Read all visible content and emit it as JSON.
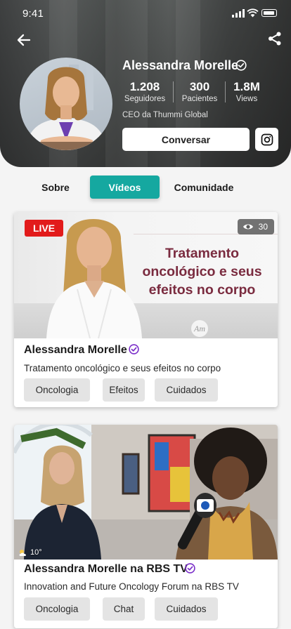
{
  "status_bar": {
    "time": "9:41"
  },
  "profile": {
    "name": "Alessandra Morelle",
    "stats": [
      {
        "value": "1.208",
        "label": "Seguidores"
      },
      {
        "value": "300",
        "label": "Pacientes"
      },
      {
        "value": "1.8M",
        "label": "Views"
      }
    ],
    "role": "CEO da Thummi Global",
    "message_button": "Conversar"
  },
  "tabs": [
    {
      "label": "Sobre",
      "active": false
    },
    {
      "label": "Vídeos",
      "active": true
    },
    {
      "label": "Comunidade",
      "active": false
    }
  ],
  "videos": [
    {
      "badge": "LIVE",
      "views": "30",
      "thumbnail_text": "Tratamento oncológico e seus efeitos no corpo",
      "title": "Alessandra  Morelle",
      "description": "Tratamento oncológico e seus efeitos no corpo",
      "tags": [
        "Oncologia",
        "Efeitos",
        "Cuidados"
      ]
    },
    {
      "weather": "10°",
      "title": "Alessandra Morelle na RBS TV",
      "description": "Innovation and Future Oncology Forum na RBS TV",
      "tags": [
        "Oncologia",
        "Chat",
        "Cuidados"
      ]
    }
  ],
  "colors": {
    "accent": "#15a8a0",
    "verified": "#7a2ec9",
    "live": "#e21b1b",
    "headline": "#7a2b3f"
  }
}
